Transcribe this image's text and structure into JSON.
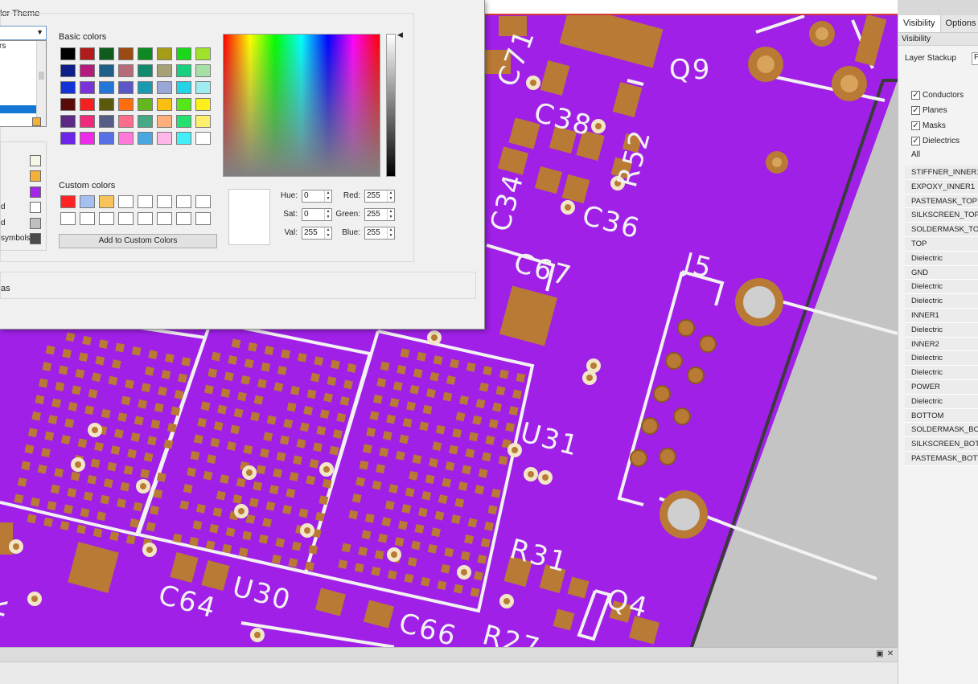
{
  "dialog": {
    "title": "lor Theme",
    "theme_select_value": "",
    "theme_list_item": "rs",
    "left_labels": [
      "",
      "",
      "",
      "d",
      "symbols"
    ],
    "left_swatches": [
      "#f6f6e4",
      "#f2b13a",
      "#a227e6",
      "#ffffff",
      "#bfbfbf",
      "#4a4a4a"
    ],
    "basic_colors_label": "Basic colors",
    "basic_colors": [
      "#000000",
      "#b21b1b",
      "#0f5c1e",
      "#9b4a14",
      "#0d8a22",
      "#a69d16",
      "#18d818",
      "#9fe228",
      "#0d1f87",
      "#b41b7c",
      "#1f5e89",
      "#b76b78",
      "#138a6c",
      "#a6a077",
      "#18d07d",
      "#a6e0a6",
      "#1433d7",
      "#7b33d9",
      "#2576d6",
      "#5b57c6",
      "#1a9ab0",
      "#9aa6d6",
      "#25d3e6",
      "#9eecf0",
      "#5b0a0a",
      "#f52020",
      "#5a5a0a",
      "#ff6d0f",
      "#63b71d",
      "#fbbf12",
      "#55e71a",
      "#fbf019",
      "#5c2a86",
      "#ef2a7a",
      "#555d86",
      "#ff6d8a",
      "#46a884",
      "#ffb07a",
      "#25e070",
      "#fcef6e",
      "#6b24e8",
      "#ef2ae9",
      "#5870e6",
      "#ff7ad8",
      "#4aa8e0",
      "#ffb7e8",
      "#42eef7",
      "#ffffff"
    ],
    "custom_colors_label": "Custom colors",
    "custom_colors": [
      "#ff2222",
      "#a4bff1",
      "#f7c35a",
      "#ffffff",
      "#ffffff",
      "#ffffff",
      "#ffffff",
      "#ffffff",
      "#ffffff",
      "#ffffff",
      "#ffffff",
      "#ffffff",
      "#ffffff",
      "#ffffff",
      "#ffffff",
      "#ffffff"
    ],
    "add_button": "Add to Custom Colors",
    "hsv": [
      {
        "label": "Hue:",
        "value": "0"
      },
      {
        "label": "Sat:",
        "value": "0"
      },
      {
        "label": "Val:",
        "value": "255"
      }
    ],
    "rgb": [
      {
        "label": "Red:",
        "value": "255"
      },
      {
        "label": "Green:",
        "value": "255"
      },
      {
        "label": "Blue:",
        "value": "255"
      }
    ],
    "bottom_label": "as"
  },
  "right_panel": {
    "tabs": [
      "Visibility",
      "Options"
    ],
    "subheader": "Visibility",
    "stackup_label": "Layer Stackup",
    "stackup_value": "P",
    "checks": [
      "Conductors",
      "Planes",
      "Masks",
      "Dielectrics"
    ],
    "all_label": "All",
    "layers": [
      "STIFFNER_INNER1",
      "EXPOXY_INNER1",
      "PASTEMASK_TOP",
      "SILKSCREEN_TOP",
      "SOLDERMASK_TOP",
      "TOP",
      "Dielectric",
      "GND",
      "Dielectric",
      "Dielectric",
      "INNER1",
      "Dielectric",
      "INNER2",
      "Dielectric",
      "Dielectric",
      "POWER",
      "Dielectric",
      "BOTTOM",
      "SOLDERMASK_BOTTOM",
      "SILKSCREEN_BOTTOM",
      "PASTEMASK_BOTTOM"
    ]
  },
  "pcb": {
    "board_color": "#a020e8",
    "pad_color": "#b87a35",
    "silk_color": "#f2f2f2",
    "designators": [
      "Q9",
      "C71",
      "C38",
      "R52",
      "C34",
      "C36",
      "C67",
      "J5",
      "U31",
      "R31",
      "C64",
      "U30",
      "C66",
      "R27",
      "Q4",
      "R"
    ]
  },
  "bottom_panel": {
    "restore_icon": "▣",
    "close_icon": "✕"
  }
}
